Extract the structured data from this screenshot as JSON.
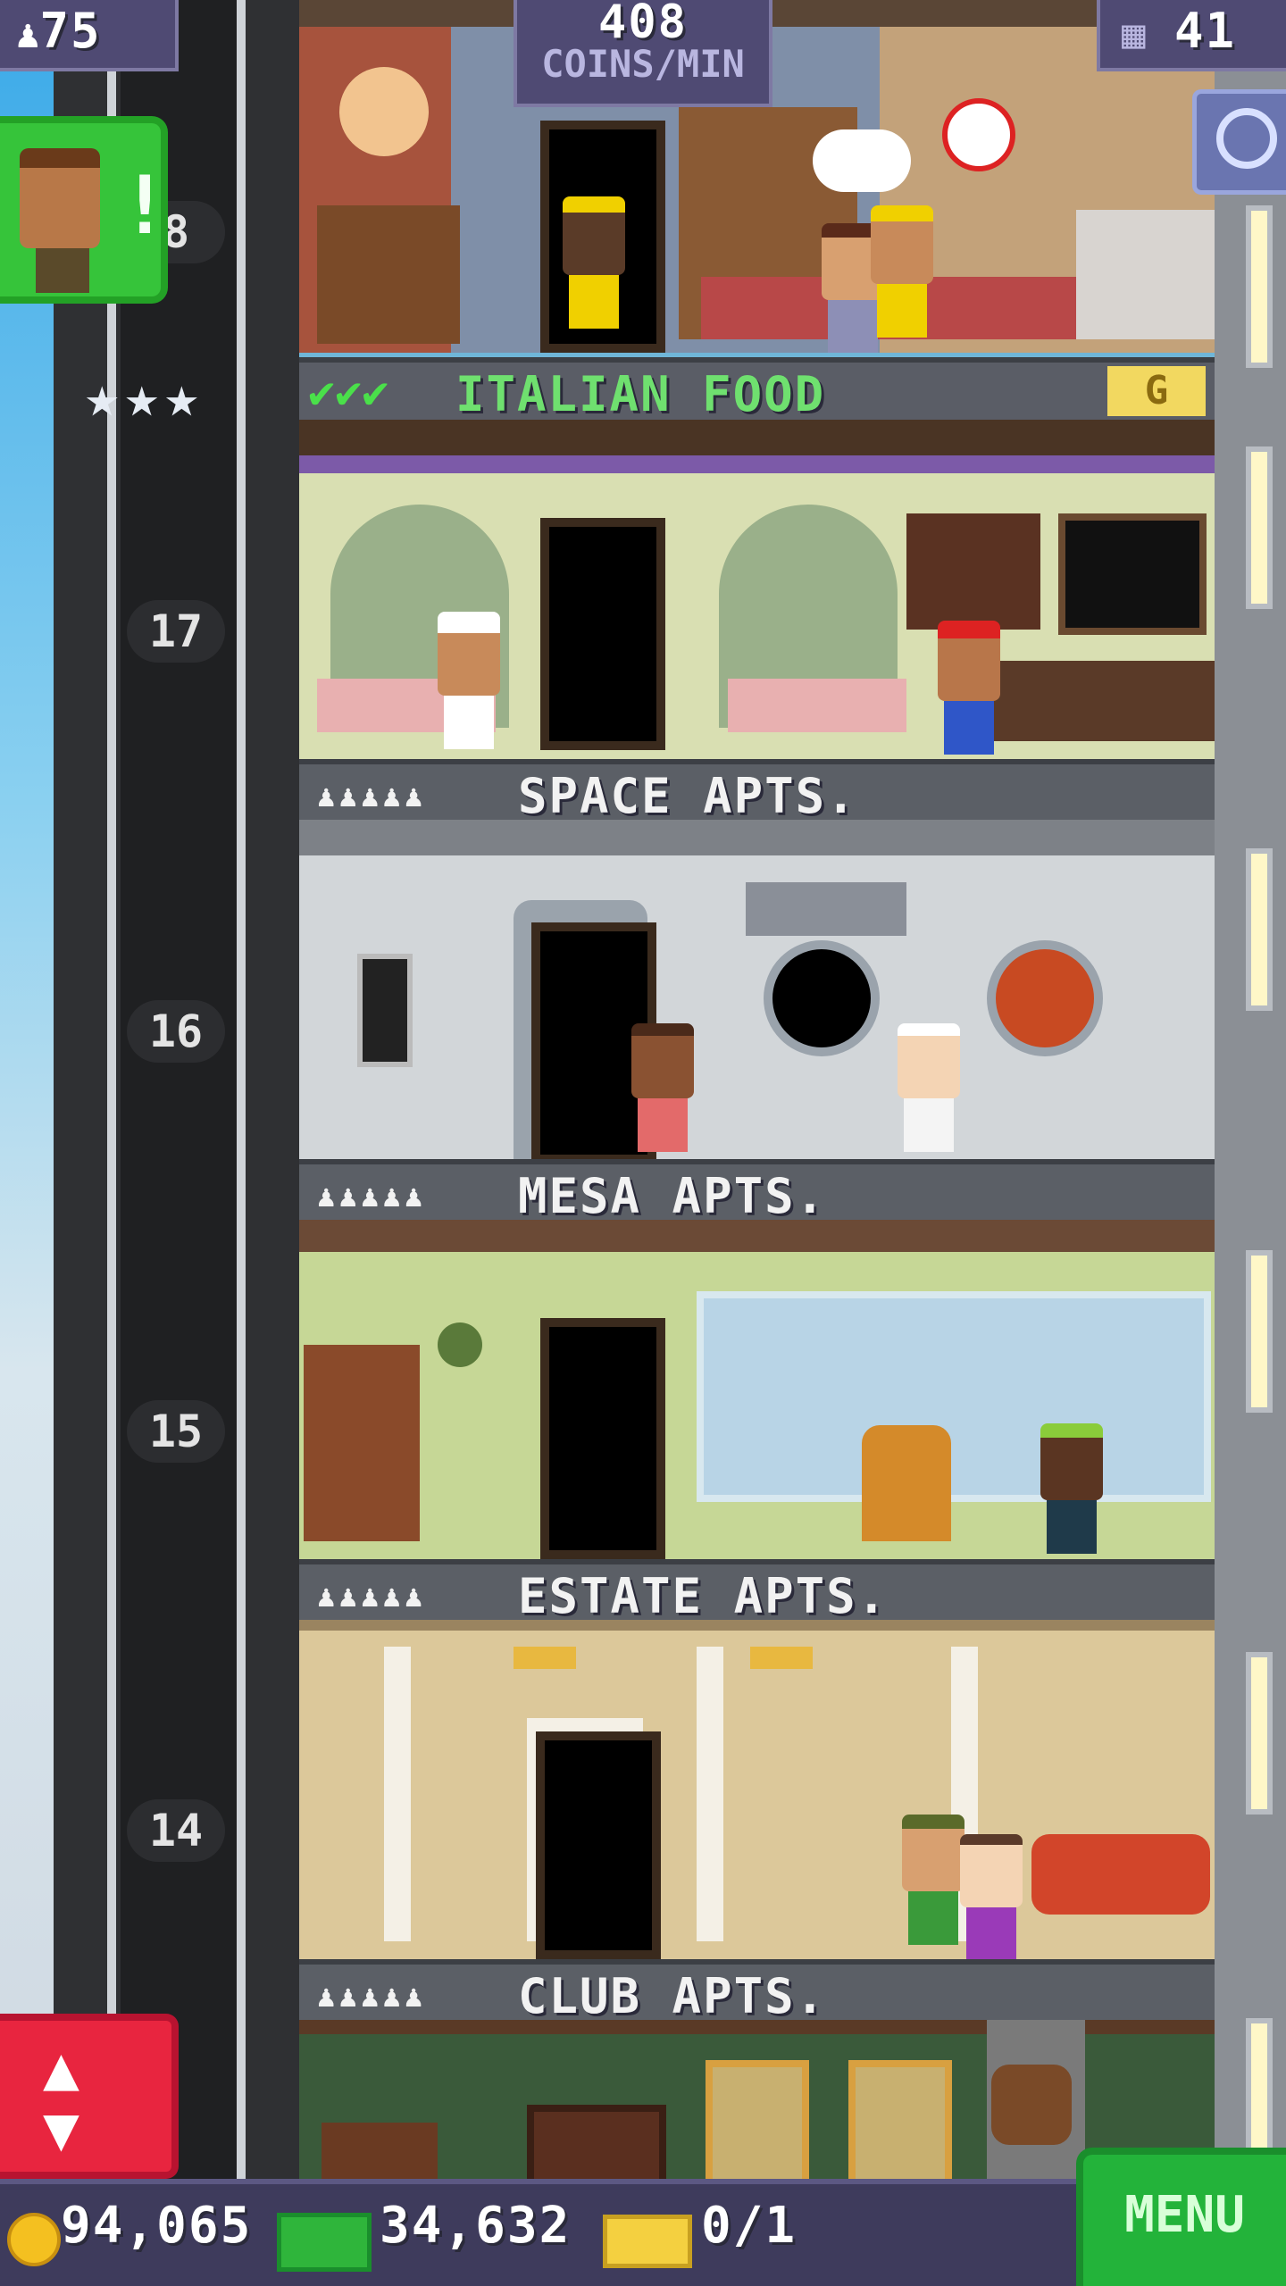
{
  "hud": {
    "population": "75",
    "coins_per_min_value": "408",
    "coins_per_min_label": "COINS/MIN",
    "floor_count": "41"
  },
  "elevator_floor_numbers": [
    "8",
    "17",
    "16",
    "15",
    "14"
  ],
  "floors": [
    {
      "id": "italian-food",
      "name": "ITALIAN FOOD",
      "type": "food",
      "checks": 3,
      "badge": "G"
    },
    {
      "id": "space-apts",
      "name": "SPACE APTS.",
      "type": "residential",
      "residents_icons": "♟♟♟♟♟"
    },
    {
      "id": "mesa-apts",
      "name": "MESA APTS.",
      "type": "residential",
      "residents_icons": "♟♟♟♟♟"
    },
    {
      "id": "estate-apts",
      "name": "ESTATE APTS.",
      "type": "residential",
      "residents_icons": "♟♟♟♟♟"
    },
    {
      "id": "club-apts",
      "name": "CLUB APTS.",
      "type": "residential",
      "residents_icons": "♟♟♟♟♟"
    }
  ],
  "vip_alert": "!",
  "stars": 3,
  "bottom": {
    "coins": "94,065",
    "bux": "34,632",
    "tickets": "0/1",
    "menu_label": "MENU"
  },
  "colors": {
    "hud_bg": "#4f4a73",
    "green_button": "#36c43a",
    "red_button": "#e8253f",
    "coin": "#f4c020",
    "bux": "#2fb53b"
  }
}
